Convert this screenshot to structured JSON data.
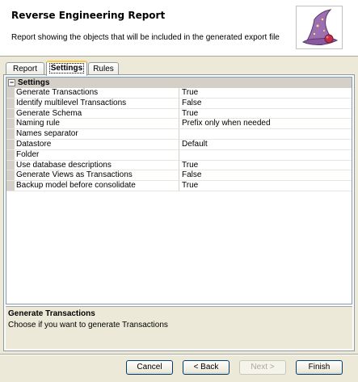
{
  "header": {
    "title": "Reverse Engineering Report",
    "description": "Report showing the objects that will be included in the generated export file",
    "logo_icon": "wizard-hat-icon"
  },
  "tabs": [
    {
      "label": "Report",
      "active": false
    },
    {
      "label": "Settings",
      "active": true
    },
    {
      "label": "Rules",
      "active": false
    }
  ],
  "properties": {
    "category": "Settings",
    "rows": [
      {
        "name": "Generate Transactions",
        "value": "True"
      },
      {
        "name": "Identify multilevel Transactions",
        "value": "False"
      },
      {
        "name": "Generate Schema",
        "value": "True"
      },
      {
        "name": "Naming rule",
        "value": "Prefix only when needed"
      },
      {
        "name": "Names separator",
        "value": ""
      },
      {
        "name": "Datastore",
        "value": "Default"
      },
      {
        "name": "Folder",
        "value": ""
      },
      {
        "name": "Use database descriptions",
        "value": "True"
      },
      {
        "name": "Generate Views as Transactions",
        "value": "False"
      },
      {
        "name": "Backup model before consolidate",
        "value": "True"
      }
    ]
  },
  "description": {
    "title": "Generate Transactions",
    "text": "Choose if you want to generate Transactions"
  },
  "buttons": {
    "cancel": "Cancel",
    "back": "< Back",
    "next": "Next >",
    "finish": "Finish"
  },
  "colors": {
    "active_tab_accent": "#ffc83c",
    "button_border": "#003c74",
    "dialog_background": "#ece9d8"
  }
}
